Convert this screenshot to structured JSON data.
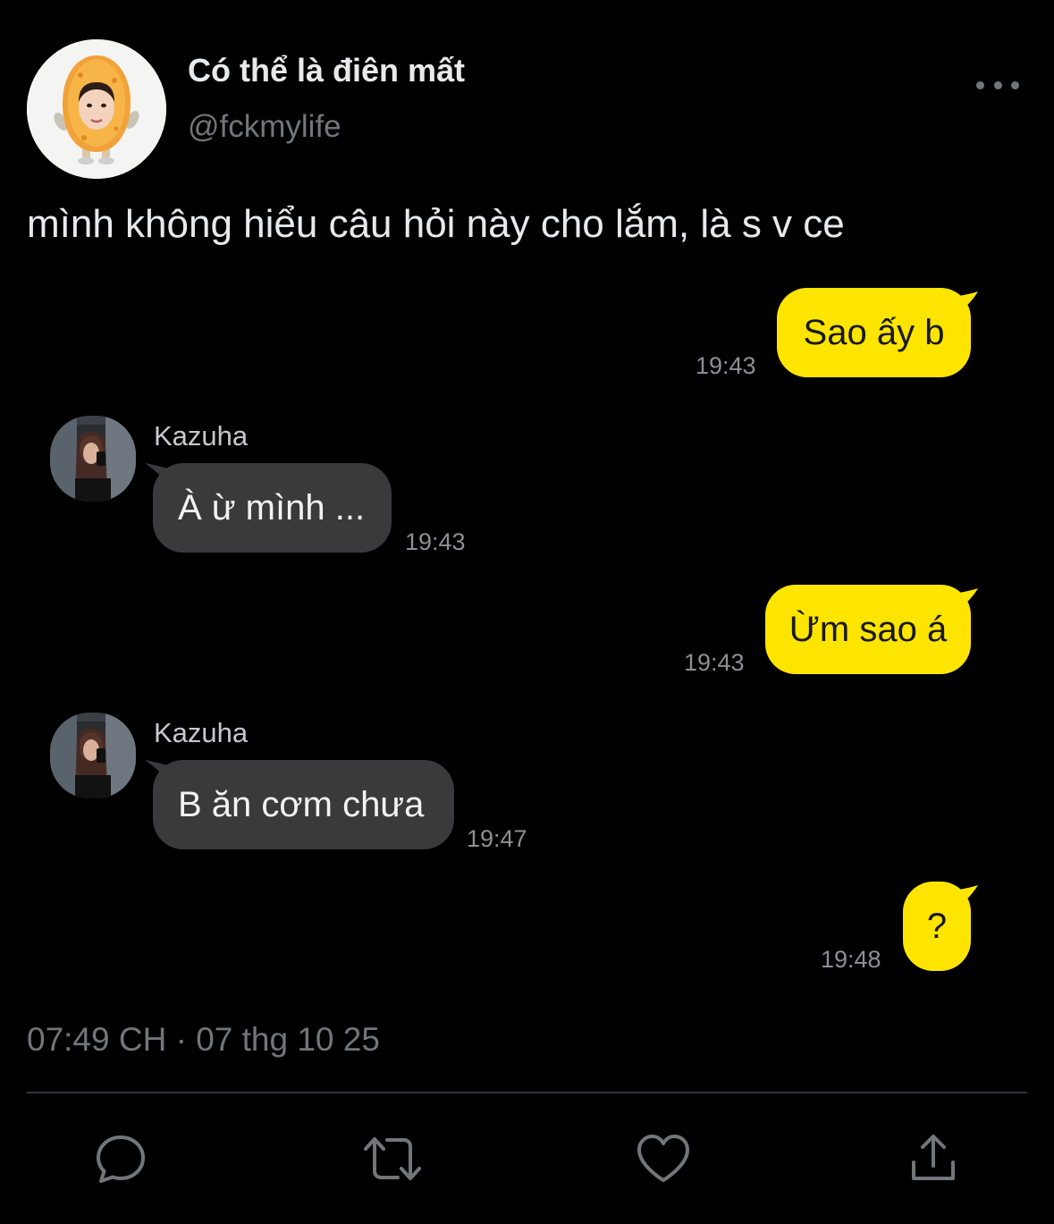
{
  "author": {
    "display_name": "Có thể là điên mất",
    "handle": "@fckmylife",
    "avatar_icon": "nugget-avatar-icon"
  },
  "tweet": {
    "text": "mình không hiểu câu hỏi này cho lắm, là s v ce",
    "time": "07:49 CH",
    "separator": "·",
    "date": "07 thg 10 25"
  },
  "chat": {
    "messages": [
      {
        "from": "me",
        "text": "Sao ấy b",
        "time": "19:43"
      },
      {
        "from": "them",
        "sender": "Kazuha",
        "text": "À ừ mình ...",
        "time": "19:43"
      },
      {
        "from": "me",
        "text": "Ừm sao á",
        "time": "19:43"
      },
      {
        "from": "them",
        "sender": "Kazuha",
        "text": "B ăn cơm chưa",
        "time": "19:47"
      },
      {
        "from": "me",
        "text": "?",
        "time": "19:48"
      }
    ],
    "colors": {
      "my_bubble": "#fee500",
      "their_bubble": "#3a3a3c"
    }
  },
  "actions": {
    "icons": [
      "reply-icon",
      "retweet-icon",
      "like-icon",
      "share-icon"
    ]
  },
  "colors": {
    "background": "#000000",
    "primary_text": "#e7e9ea",
    "secondary_text": "#71767b"
  }
}
